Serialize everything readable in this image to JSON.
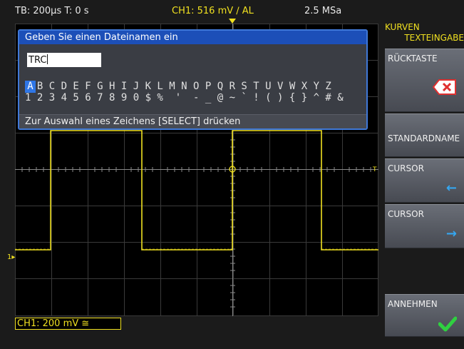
{
  "status": {
    "timebase": "TB: 200µs  T: 0 s",
    "trigger": "CH1: 516 mV ∕ AL",
    "sample_rate": "2.5 MSa"
  },
  "dialog": {
    "title": "Geben Sie einen Dateinamen ein",
    "input_value": "TRC",
    "selected_char": "A",
    "row1": "A B C D E F G H I J K L M N O P Q R S T U V W X Y Z",
    "row2": "1 2 3 4 5 6 7 8 9 0 $ %  '  - _ @ ~ ` ! ( ) { } ^ # &",
    "hint": "Zur Auswahl eines Zeichens [SELECT] drücken"
  },
  "channel": {
    "label": "CH1: 200 mV ≅",
    "color": "#f0e020"
  },
  "markers": {
    "ground": "1",
    "trigger_level": "T"
  },
  "menu": {
    "title_line1": "KURVEN",
    "title_line2": "TEXTEINGABE",
    "backspace": "RÜCKTASTE",
    "default_name": "STANDARDNAME",
    "cursor_left": "CURSOR",
    "cursor_right": "CURSOR",
    "accept": "ANNEHMEN",
    "arrow_left": "←",
    "arrow_right": "→"
  },
  "colors": {
    "trace": "#f0e020",
    "dialog_title": "#1c4fb8",
    "highlight": "#2f76e6",
    "accept_check": "#2fd040",
    "backspace_icon": "#e03030",
    "arrow": "#35a6f0"
  }
}
